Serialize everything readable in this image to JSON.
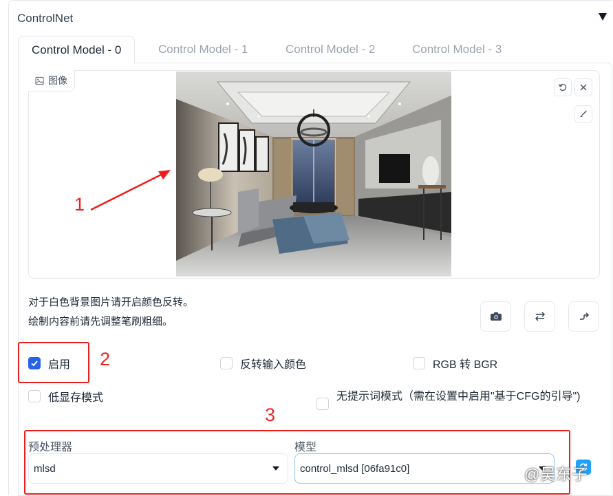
{
  "header": {
    "title": "ControlNet"
  },
  "tabs": [
    {
      "label": "Control Model - 0"
    },
    {
      "label": "Control Model - 1"
    },
    {
      "label": "Control Model - 2"
    },
    {
      "label": "Control Model - 3"
    }
  ],
  "image": {
    "label": "图像"
  },
  "hints": {
    "line1": "对于白色背景图片请开启颜色反转。",
    "line2": "绘制内容前请先调整笔刷粗细。"
  },
  "checkboxes": {
    "enable": {
      "label": "启用",
      "checked": true
    },
    "invert": {
      "label": "反转输入颜色",
      "checked": false
    },
    "rgb_bgr": {
      "label": "RGB 转 BGR",
      "checked": false
    },
    "low_vram": {
      "label": "低显存模式",
      "checked": false
    },
    "guess_mode": {
      "label": "无提示词模式（需在设置中启用\"基于CFG的引导\")",
      "checked": false
    }
  },
  "preprocessor": {
    "label": "预处理器",
    "value": "mlsd"
  },
  "model": {
    "label": "模型",
    "value": "control_mlsd [06fa91c0]"
  },
  "annotations": {
    "n1": "1",
    "n2": "2",
    "n3": "3"
  },
  "watermark": "@吴东子",
  "colors": {
    "accent": "#2563eb",
    "annotation_red": "#ef1c1c"
  }
}
